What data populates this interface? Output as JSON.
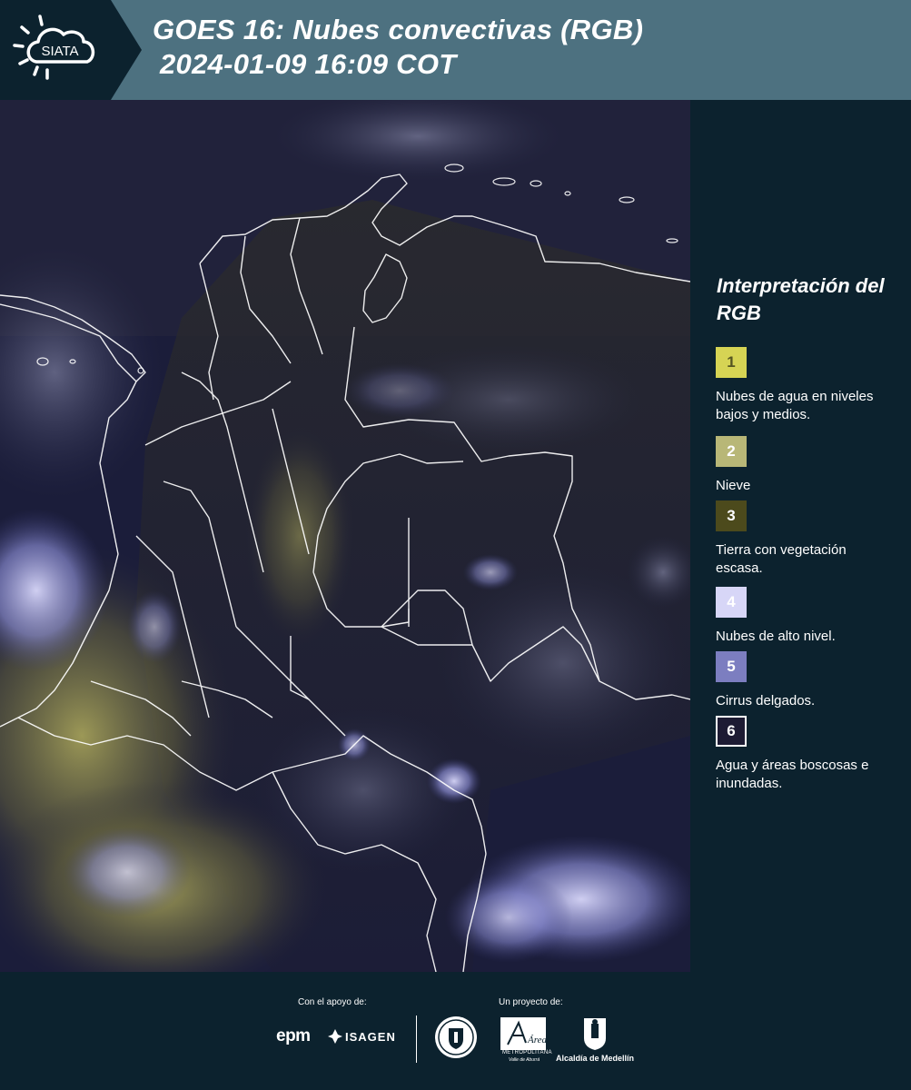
{
  "header": {
    "logo_text": "SIATA",
    "title_line1": "GOES 16: Nubes convectivas (RGB)",
    "title_line2": "2024-01-09 16:09 COT"
  },
  "legend": {
    "title": "Interpretación del RGB",
    "items": [
      {
        "number": "1",
        "color": "#d6d454",
        "text_color": "#555522",
        "label": "Nubes de agua en niveles bajos y medios."
      },
      {
        "number": "2",
        "color": "#b8b777",
        "text_color": "#ffffff",
        "label": "Nieve"
      },
      {
        "number": "3",
        "color": "#4c4a1c",
        "text_color": "#ffffff",
        "label": "Tierra con vegetación escasa."
      },
      {
        "number": "4",
        "color": "#d7d6f7",
        "text_color": "#ffffff",
        "label": "Nubes de alto nivel."
      },
      {
        "number": "5",
        "color": "#7c7ec0",
        "text_color": "#ffffff",
        "label": "Cirrus delgados."
      },
      {
        "number": "6",
        "color": "#1d1b33",
        "text_color": "#ffffff",
        "label": "Agua y áreas boscosas e inundadas."
      }
    ]
  },
  "map": {
    "background_color": "#1b1d3a",
    "border_color": "#ffffff",
    "icon": "satellite-rgb-map"
  },
  "footer": {
    "support_label": "Con el apoyo de:",
    "project_label": "Un proyecto de:",
    "epm": "epm",
    "isagen": "ISAGEN",
    "amva_line1": "METROPOLITANA",
    "amva_line2": "Valle de Aburrá",
    "amva_script": "Área",
    "alcaldia": "Alcaldía de Medellín"
  }
}
